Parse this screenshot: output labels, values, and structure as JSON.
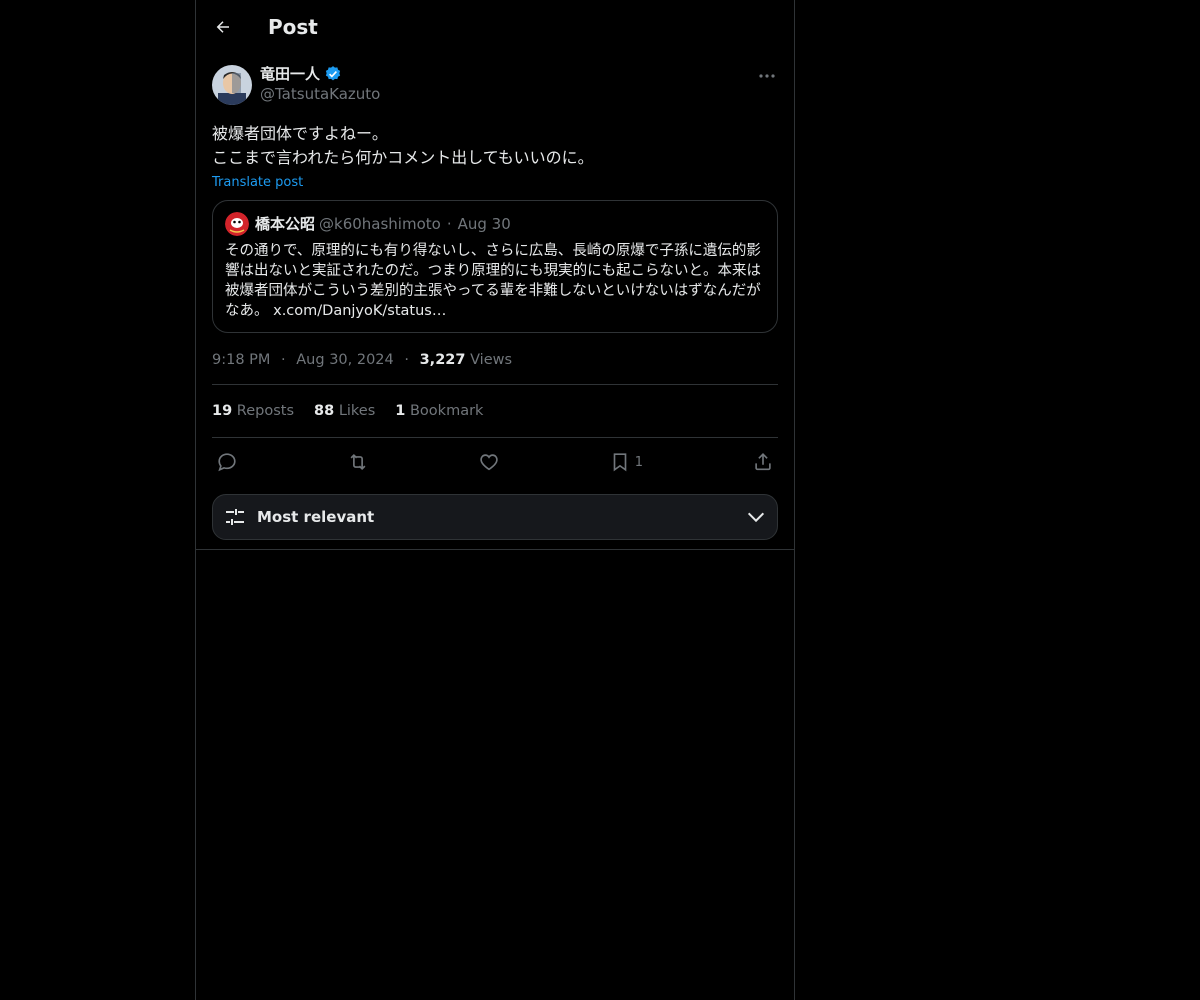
{
  "header": {
    "title": "Post",
    "back_icon": "arrow-left-icon"
  },
  "author": {
    "name": "竜田一人",
    "handle": "@TatsutaKazuto",
    "verified": true,
    "verified_color": "#1d9bf0"
  },
  "post": {
    "text_line1": "被爆者団体ですよねー。",
    "text_line2": "ここまで言われたら何かコメント出してもいいのに。",
    "translate_label": "Translate post"
  },
  "quote": {
    "name": "橋本公昭",
    "handle": "@k60hashimoto",
    "separator": "·",
    "date": "Aug 30",
    "text": "その通りで、原理的にも有り得ないし、さらに広島、長崎の原爆で子孫に遺伝的影響は出ないと実証されたのだ。つまり原理的にも現実的にも起こらないと。本来は被爆者団体がこういう差別的主張やってる輩を非難しないといけないはずなんだがなあ。 x.com/DanjyoK/status…"
  },
  "meta": {
    "time": "9:18 PM",
    "separator": "·",
    "date": "Aug 30, 2024",
    "views_count": "3,227",
    "views_label": "Views"
  },
  "stats": {
    "reposts_count": "19",
    "reposts_label": "Reposts",
    "likes_count": "88",
    "likes_label": "Likes",
    "bookmarks_count": "1",
    "bookmarks_label": "Bookmark"
  },
  "actions": {
    "reply_icon": "reply-icon",
    "repost_icon": "repost-icon",
    "like_icon": "heart-icon",
    "bookmark_icon": "bookmark-icon",
    "bookmark_count": "1",
    "share_icon": "share-icon"
  },
  "sort": {
    "label": "Most relevant"
  },
  "colors": {
    "background": "#000000",
    "border": "#2f3336",
    "muted": "#71767b",
    "accent": "#1d9bf0"
  }
}
